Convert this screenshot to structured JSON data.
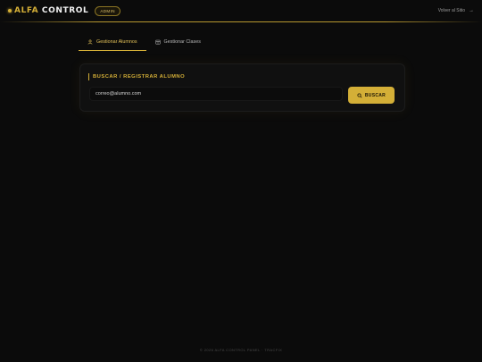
{
  "header": {
    "logo_accent": "ALFA",
    "logo_rest": "CONTROL",
    "badge": "ADMIN",
    "back_link": "Volver al Sitio"
  },
  "tabs": [
    {
      "label": "Gestionar Alumnos",
      "active": true,
      "icon": "user-icon"
    },
    {
      "label": "Gestionar Clases",
      "active": false,
      "icon": "calendar-icon"
    }
  ],
  "panel": {
    "title": "BUSCAR / REGISTRAR ALUMNO",
    "input_value": "correo@alumno.com",
    "button_label": "BUSCAR"
  },
  "footer": {
    "text": "© 2026 ALFA CONTROL PANEL · TRACFIX"
  },
  "colors": {
    "accent": "#d4af37",
    "background": "#0b0b0b",
    "panel": "#101010"
  }
}
